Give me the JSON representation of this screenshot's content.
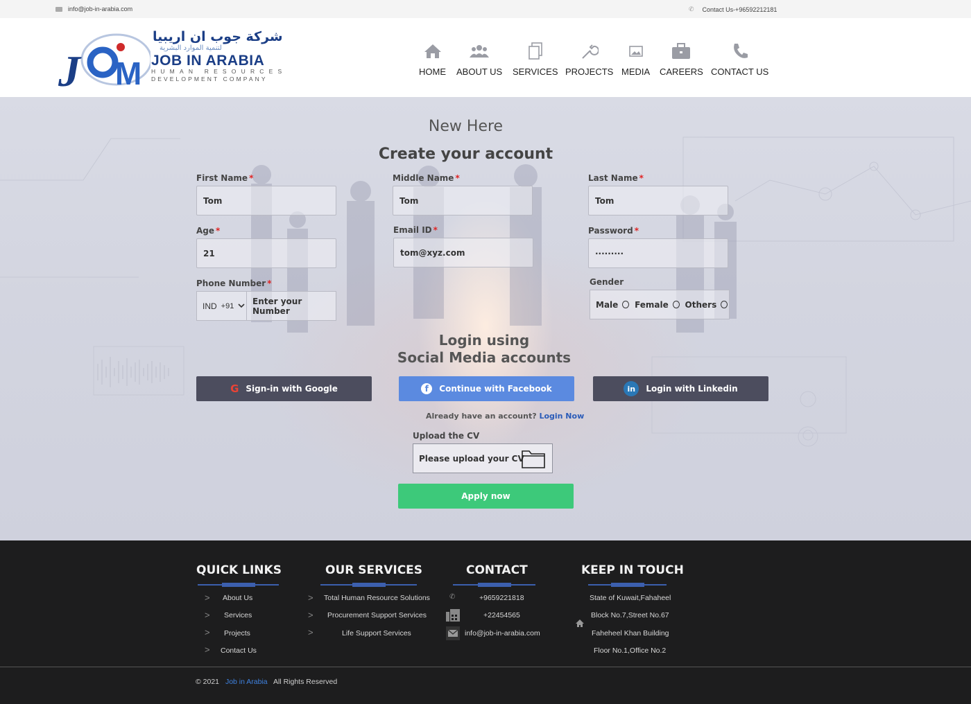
{
  "topbar": {
    "email": "info@job-in-arabia.com",
    "phone": "Contact Us-+96592212181"
  },
  "logo": {
    "arabic": "شركة جوب ان اريبيا",
    "arabic_sub": "لتنمية الموارد البشرية",
    "brand": "JOB IN ARABIA",
    "line1": "HUMAN RESOURCES",
    "line2": "DEVELOPMENT COMPANY"
  },
  "nav": [
    {
      "label": "HOME",
      "icon": "home-icon"
    },
    {
      "label": "ABOUT US",
      "icon": "users-icon"
    },
    {
      "label": "SERVICES",
      "icon": "copy-icon"
    },
    {
      "label": "PROJECTS",
      "icon": "wrench-icon"
    },
    {
      "label": "MEDIA",
      "icon": "image-icon"
    },
    {
      "label": "CAREERS",
      "icon": "briefcase-icon"
    },
    {
      "label": "CONTACT US",
      "icon": "phone-icon"
    }
  ],
  "form": {
    "heading": "New Here",
    "subheading": "Create your account",
    "first_name": {
      "label": "First Name",
      "value": "Tom"
    },
    "middle_name": {
      "label": "Middle Name",
      "value": "Tom"
    },
    "last_name": {
      "label": "Last Name",
      "value": "Tom"
    },
    "age": {
      "label": "Age",
      "value": "21"
    },
    "email": {
      "label": "Email ID",
      "value": "tom@xyz.com"
    },
    "password": {
      "label": "Password",
      "value": "·········"
    },
    "phone": {
      "label": "Phone Number",
      "country": "IND",
      "code": "+91",
      "placeholder": "Enter your Number"
    },
    "gender": {
      "label": "Gender",
      "options": [
        "Male",
        "Female",
        "Others"
      ]
    },
    "required_mark": "*"
  },
  "social": {
    "title_line1": "Login using",
    "title_line2": "Social Media accounts",
    "google": "Sign-in with Google",
    "facebook": "Continue with Facebook",
    "linkedin": "Login with Linkedin",
    "already": "Already have an account?",
    "login_now": "Login Now"
  },
  "upload": {
    "label": "Upload the CV",
    "placeholder": "Please upload your CV"
  },
  "apply": "Apply now",
  "colors": {
    "brand_blue": "#1b3e86",
    "facebook": "#5b8ae0",
    "apply_green": "#3dc97a",
    "footer_bg": "#1d1d1e",
    "accent_line": "#3c5fae"
  },
  "footer": {
    "quick_links": {
      "title": "QUICK LINKS",
      "items": [
        "About Us",
        "Services",
        "Projects",
        "Contact Us"
      ]
    },
    "services": {
      "title": "OUR SERVICES",
      "items": [
        "Total Human Resource Solutions",
        "Procurement Support Services",
        "Life Support Services"
      ]
    },
    "contact": {
      "title": "CONTACT",
      "phone": "+9659221818",
      "fax": "+22454565",
      "email": "info@job-in-arabia.com"
    },
    "touch": {
      "title": "KEEP IN TOUCH",
      "lines": [
        "State of Kuwait,Fahaheel",
        "Block No.7,Street No.67",
        "Faheheel Khan Building",
        "Floor No.1,Office No.2"
      ]
    },
    "copyright_prefix": "© 2021",
    "copyright_brand": "Job in Arabia",
    "copyright_suffix": "All Rights Reserved"
  }
}
